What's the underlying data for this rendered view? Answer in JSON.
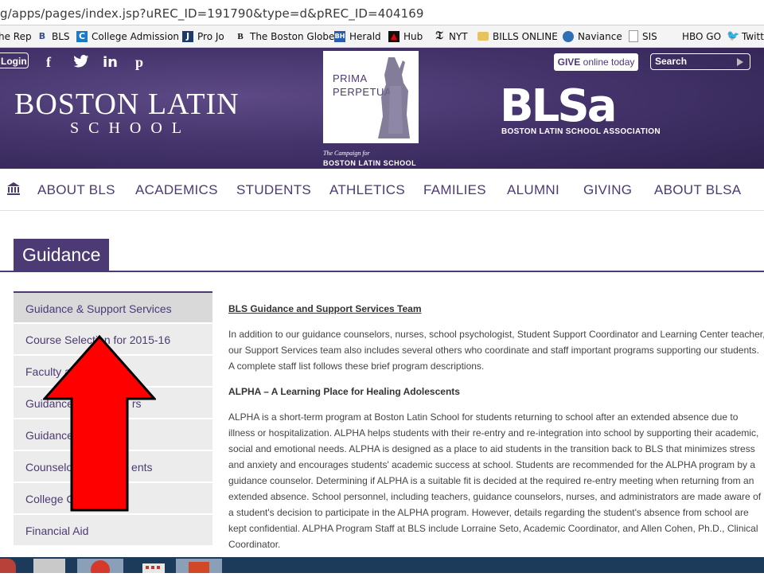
{
  "browser": {
    "url": "g/apps/pages/index.jsp?uREC_ID=191790&type=d&pREC_ID=404169"
  },
  "bookmarks": [
    {
      "label": "he Rep",
      "icon": "none"
    },
    {
      "label": "BLS",
      "icon": "bls-icon"
    },
    {
      "label": "College Admission",
      "icon": "c-icon"
    },
    {
      "label": "Pro Jo",
      "icon": "j-icon"
    },
    {
      "label": "The Boston Globe",
      "icon": "globe-icon"
    },
    {
      "label": "Herald",
      "icon": "herald-icon"
    },
    {
      "label": "Hub",
      "icon": "hub-icon"
    },
    {
      "label": "NYT",
      "icon": "nyt-icon"
    },
    {
      "label": "BILLS ONLINE",
      "icon": "folder-icon"
    },
    {
      "label": "Naviance",
      "icon": "naviance-icon"
    },
    {
      "label": "SIS",
      "icon": "page-icon"
    },
    {
      "label": "HBO GO",
      "icon": "none"
    },
    {
      "label": "Twitt",
      "icon": "twitter-icon"
    }
  ],
  "header": {
    "login_label": "Login",
    "logo_top": "BOSTON LATIN",
    "logo_sub": "SCHOOL",
    "campaign_line1": "PRIMA",
    "campaign_line2": "PERPETUA",
    "campaign_tag1": "The Campaign for",
    "campaign_tag2": "BOSTON LATIN SCHOOL",
    "give_bold": "GIVE",
    "give_rest": " online today",
    "search_placeholder": "Search",
    "blsa_logo": "BLSa",
    "blsa_sub": "BOSTON LATIN SCHOOL ASSOCIATION"
  },
  "nav": {
    "items": [
      "ABOUT BLS",
      "ACADEMICS",
      "STUDENTS",
      "ATHLETICS",
      "FAMILIES",
      "ALUMNI",
      "GIVING",
      "ABOUT BLSA"
    ]
  },
  "page": {
    "title": "Guidance"
  },
  "sidebar": {
    "items": [
      {
        "label": "Guidance & Support Services",
        "active": true
      },
      {
        "label": "Course Selection for 2015-16",
        "active": false
      },
      {
        "label": "Faculty a",
        "active": false
      },
      {
        "label": "Guidance                   rs",
        "active": false
      },
      {
        "label": "Guidance",
        "active": false
      },
      {
        "label": "Counselo                   ents",
        "active": false
      },
      {
        "label": "College C",
        "active": false
      },
      {
        "label": "Financial Aid",
        "active": false
      }
    ]
  },
  "content": {
    "heading": "BLS Guidance and Support Services Team",
    "intro": "In addition to our guidance counselors, nurses, school psychologist, Student Support Coordinator and Learning Center teacher, our Support Services team also includes several others who coordinate and staff important programs supporting our students.  A complete staff list follows these brief program descriptions.",
    "alpha_heading": "ALPHA – A Learning Place for Healing Adolescents",
    "alpha_body": "ALPHA  is a short-term program at Boston Latin School for students returning to school after an extended absence due to illness or hospitalization.    ALPHA helps students with their re-entry and re-integration into school by supporting their academic, social and emotional needs.  ALPHA is designed as a place to aid students in the transition back to BLS that minimizes stress and anxiety and encourages students' academic success at school. Students are recommended for the ALPHA program by a guidance counselor. Determining if ALPHA is a suitable fit is decided at the required re-entry meeting when returning from an extended absence.   School personnel, including teachers, guidance counselors, nurses, and administrators are made aware of a student's decision to participate in the ALPHA program.  However, details regarding the student's absence from school are kept confidential.  ALPHA Program Staff at BLS include Lorraine Seto, Academic Coordinator, and Allen Cohen, Ph.D., Clinical Coordinator."
  },
  "colors": {
    "brand_purple": "#4b3a74",
    "arrow_red": "#ff0000"
  }
}
